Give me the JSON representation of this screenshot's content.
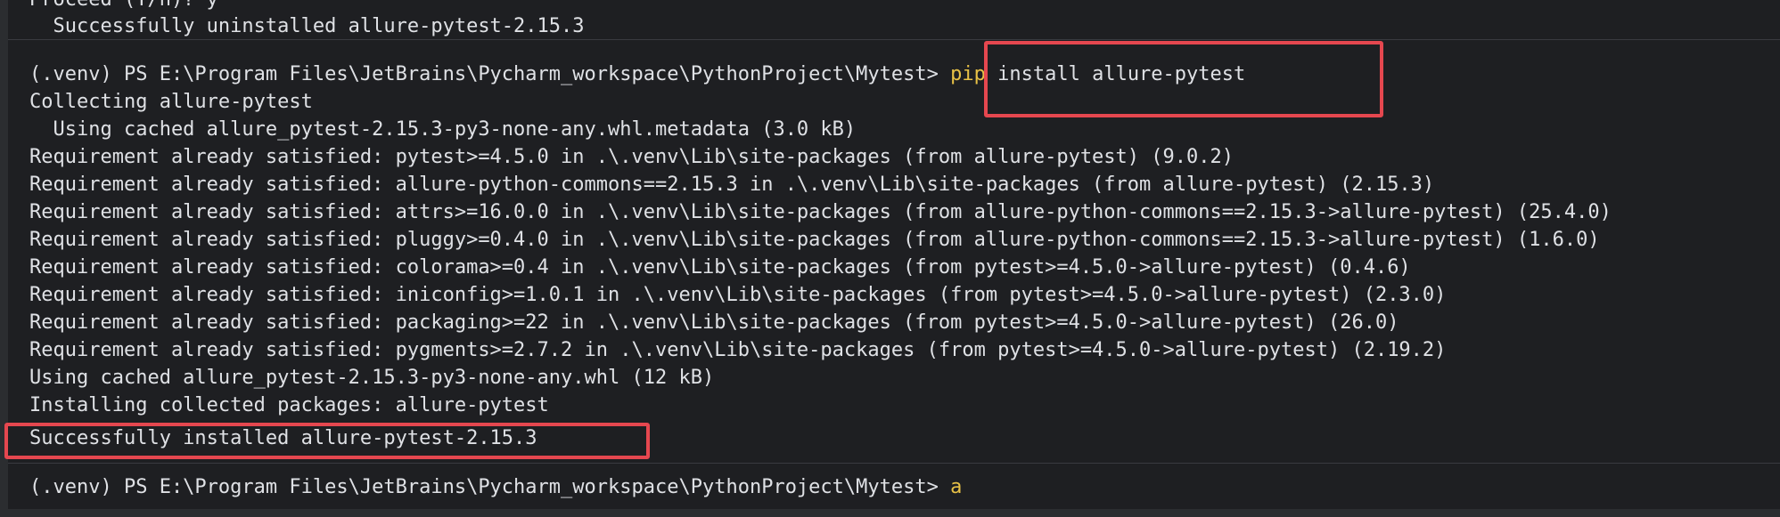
{
  "terminal": {
    "previous_block": {
      "lines": [
        "Proceed (Y/n)? y",
        "  Successfully uninstalled allure-pytest-2.15.3"
      ]
    },
    "install_block": {
      "prompt": "(.venv) PS E:\\Program Files\\JetBrains\\Pycharm_workspace\\PythonProject\\Mytest> ",
      "command_keyword": "pip",
      "command_rest": " install allure-pytest",
      "output": [
        "Collecting allure-pytest",
        "  Using cached allure_pytest-2.15.3-py3-none-any.whl.metadata (3.0 kB)",
        "Requirement already satisfied: pytest>=4.5.0 in .\\.venv\\Lib\\site-packages (from allure-pytest) (9.0.2)",
        "Requirement already satisfied: allure-python-commons==2.15.3 in .\\.venv\\Lib\\site-packages (from allure-pytest) (2.15.3)",
        "Requirement already satisfied: attrs>=16.0.0 in .\\.venv\\Lib\\site-packages (from allure-python-commons==2.15.3->allure-pytest) (25.4.0)",
        "Requirement already satisfied: pluggy>=0.4.0 in .\\.venv\\Lib\\site-packages (from allure-python-commons==2.15.3->allure-pytest) (1.6.0)",
        "Requirement already satisfied: colorama>=0.4 in .\\.venv\\Lib\\site-packages (from pytest>=4.5.0->allure-pytest) (0.4.6)",
        "Requirement already satisfied: iniconfig>=1.0.1 in .\\.venv\\Lib\\site-packages (from pytest>=4.5.0->allure-pytest) (2.3.0)",
        "Requirement already satisfied: packaging>=22 in .\\.venv\\Lib\\site-packages (from pytest>=4.5.0->allure-pytest) (26.0)",
        "Requirement already satisfied: pygments>=2.7.2 in .\\.venv\\Lib\\site-packages (from pytest>=4.5.0->allure-pytest) (2.19.2)",
        "Using cached allure_pytest-2.15.3-py3-none-any.whl (12 kB)",
        "Installing collected packages: allure-pytest",
        "Successfully installed allure-pytest-2.15.3"
      ]
    },
    "current_prompt": {
      "prompt": "(.venv) PS E:\\Program Files\\JetBrains\\Pycharm_workspace\\PythonProject\\Mytest> ",
      "input": "a"
    }
  },
  "colors": {
    "background": "#1e1f22",
    "text": "#dfe1e5",
    "command_keyword": "#e8c146",
    "highlight_border": "#e5474f"
  }
}
